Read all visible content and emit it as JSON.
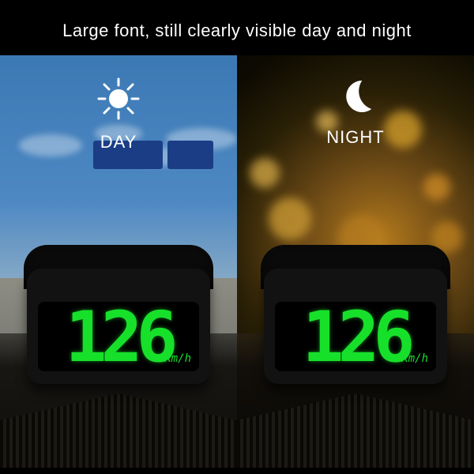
{
  "heading": "Large font, still clearly visible day and night",
  "panels": {
    "day": {
      "label": "DAY",
      "speed": "126",
      "unit": "Km/h"
    },
    "night": {
      "label": "NIGHT",
      "speed": "126",
      "unit": "Km/h"
    }
  },
  "colors": {
    "digit": "#17e02b"
  }
}
